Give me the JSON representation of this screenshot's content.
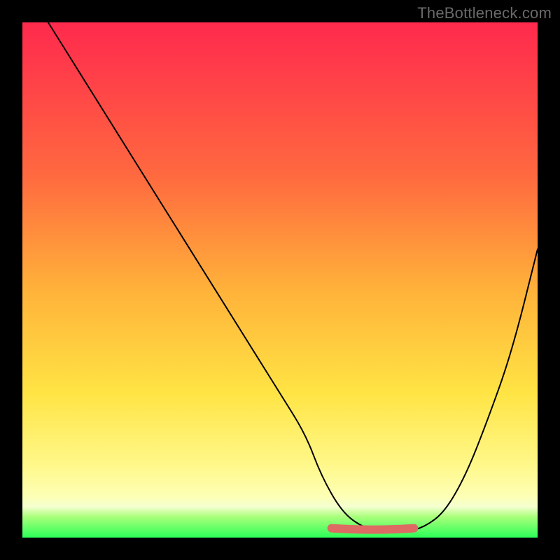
{
  "watermark": "TheBottleneck.com",
  "chart_data": {
    "type": "line",
    "title": "",
    "xlabel": "",
    "ylabel": "",
    "xlim": [
      0,
      100
    ],
    "ylim": [
      0,
      100
    ],
    "grid": false,
    "legend": false,
    "series": [
      {
        "name": "bottleneck-curve",
        "x": [
          5,
          10,
          15,
          20,
          25,
          30,
          35,
          40,
          45,
          50,
          55,
          58,
          62,
          66,
          70,
          74,
          78,
          82,
          86,
          90,
          95,
          100
        ],
        "y": [
          100,
          92,
          84,
          76,
          68,
          60,
          52,
          44,
          36,
          28,
          20,
          12,
          5,
          2,
          1,
          1,
          2,
          5,
          12,
          22,
          36,
          56
        ]
      }
    ],
    "plateau": {
      "name": "optimal-range-marker",
      "color": "#dd6a63",
      "x_start": 60,
      "x_end": 76,
      "y": 1
    }
  }
}
